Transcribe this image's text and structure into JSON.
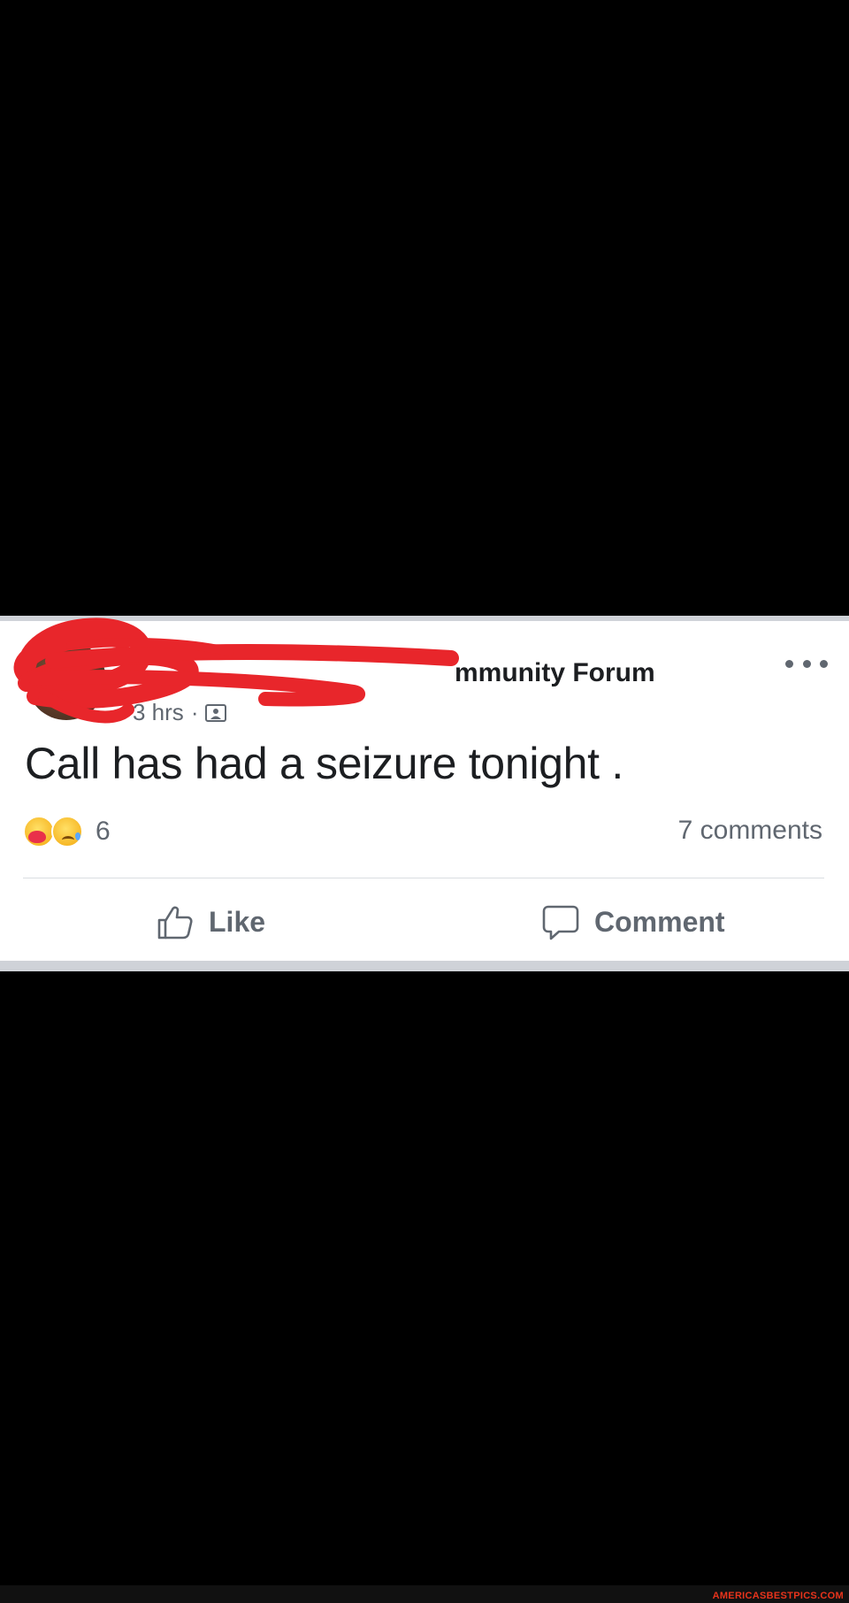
{
  "post": {
    "group_name": "mmunity Forum",
    "timestamp": "3 hrs",
    "meta_separator": "·",
    "privacy_icon": "group-members-icon",
    "text": "Call has had a seizure tonight   .",
    "reactions": {
      "icons": [
        "care-emoji",
        "sad-emoji"
      ],
      "count": "6"
    },
    "comments_label": "7 comments",
    "actions": {
      "like_label": "Like",
      "comment_label": "Comment"
    },
    "more_icon": "more-options-icon"
  },
  "colors": {
    "background": "#000000",
    "card": "#ffffff",
    "card_border": "#cfd2d8",
    "text_primary": "#1c1e21",
    "text_secondary": "#606770",
    "redaction": "#e8262b",
    "watermark_text": "#e8341c"
  },
  "watermark": {
    "text": "AMERICASBESTPICS.COM"
  }
}
